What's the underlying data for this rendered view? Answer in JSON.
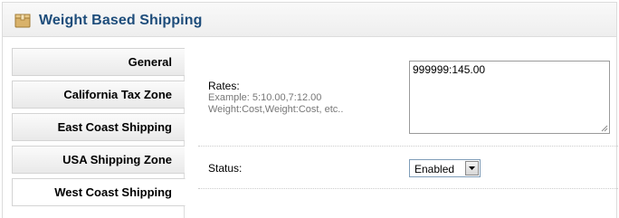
{
  "header": {
    "title": "Weight Based Shipping",
    "icon": "package-icon"
  },
  "tabs": [
    {
      "label": "General",
      "active": false
    },
    {
      "label": "California Tax Zone",
      "active": false
    },
    {
      "label": "East Coast Shipping",
      "active": false
    },
    {
      "label": "USA Shipping Zone",
      "active": false
    },
    {
      "label": "West Coast Shipping",
      "active": true
    }
  ],
  "form": {
    "rates": {
      "label": "Rates:",
      "help_line1": "Example: 5:10.00,7:12.00",
      "help_line2": "Weight:Cost,Weight:Cost, etc..",
      "value": "999999:145.00"
    },
    "status": {
      "label": "Status:",
      "selected": "Enabled"
    }
  },
  "colors": {
    "title": "#1e4d7b",
    "help_text": "#777777"
  }
}
